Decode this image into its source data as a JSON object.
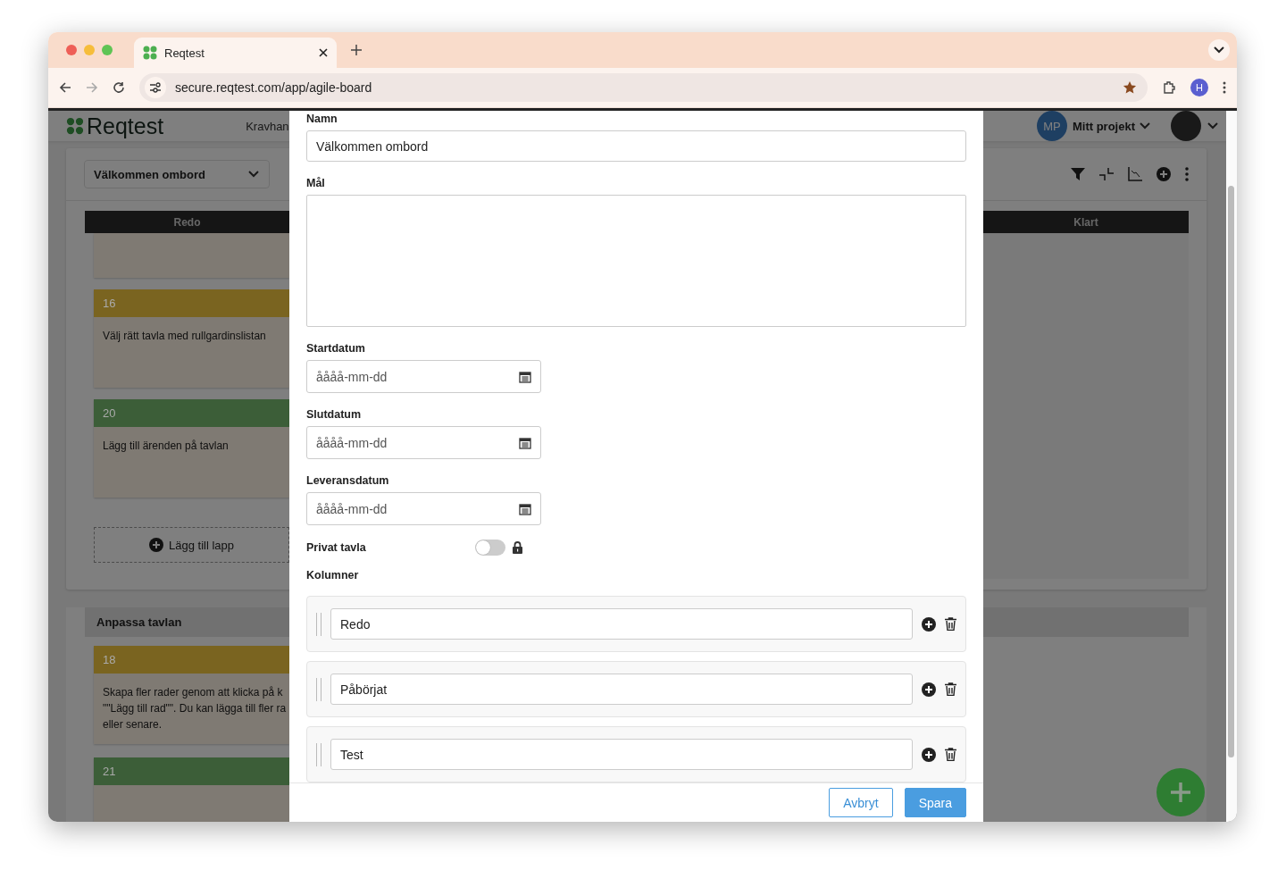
{
  "browser": {
    "tab_title": "Reqtest",
    "url": "secure.reqtest.com/app/agile-board",
    "profile_initial": "H"
  },
  "app": {
    "logo": "Reqtest",
    "nav_item": "Kravhan",
    "project": {
      "initials": "MP",
      "name": "Mitt projekt"
    }
  },
  "board": {
    "selector": "Välkommen ombord",
    "columns": [
      "Redo",
      "Klart"
    ],
    "lanes": [
      {
        "cards": [
          {
            "number": "16",
            "color": "#7a6420",
            "text": "Välj rätt tavla med rullgardinslistan"
          },
          {
            "number": "20",
            "color": "#3c5e38",
            "text": "Lägg till ärenden på tavlan"
          }
        ],
        "add_label": "Lägg till lapp"
      },
      {
        "title": "Anpassa tavlan",
        "cards": [
          {
            "number": "18",
            "color": "#7a6420",
            "text": "Skapa fler rader genom att klicka på k\n\"\"Lägg till rad\"\". Du kan lägga till fler ra\neller senare."
          },
          {
            "number": "21",
            "color": "#3c5e38"
          }
        ]
      }
    ]
  },
  "modal": {
    "fields": [
      {
        "label": "Namn",
        "kind": "text",
        "value": "Välkommen ombord"
      },
      {
        "label": "Mål",
        "kind": "textarea"
      },
      {
        "label": "Startdatum",
        "kind": "date",
        "placeholder": "åååå-mm-dd"
      },
      {
        "label": "Slutdatum",
        "kind": "date",
        "placeholder": "åååå-mm-dd"
      },
      {
        "label": "Leveransdatum",
        "kind": "date",
        "placeholder": "åååå-mm-dd"
      }
    ],
    "private": {
      "label": "Privat tavla",
      "on": false
    },
    "columns_label": "Kolumner",
    "columns": [
      {
        "value": "Redo"
      },
      {
        "value": "Påbörjat"
      },
      {
        "value": "Test"
      }
    ],
    "buttons": [
      {
        "label": "Avbryt",
        "kind": "secondary"
      },
      {
        "label": "Spara",
        "kind": "primary"
      }
    ]
  }
}
